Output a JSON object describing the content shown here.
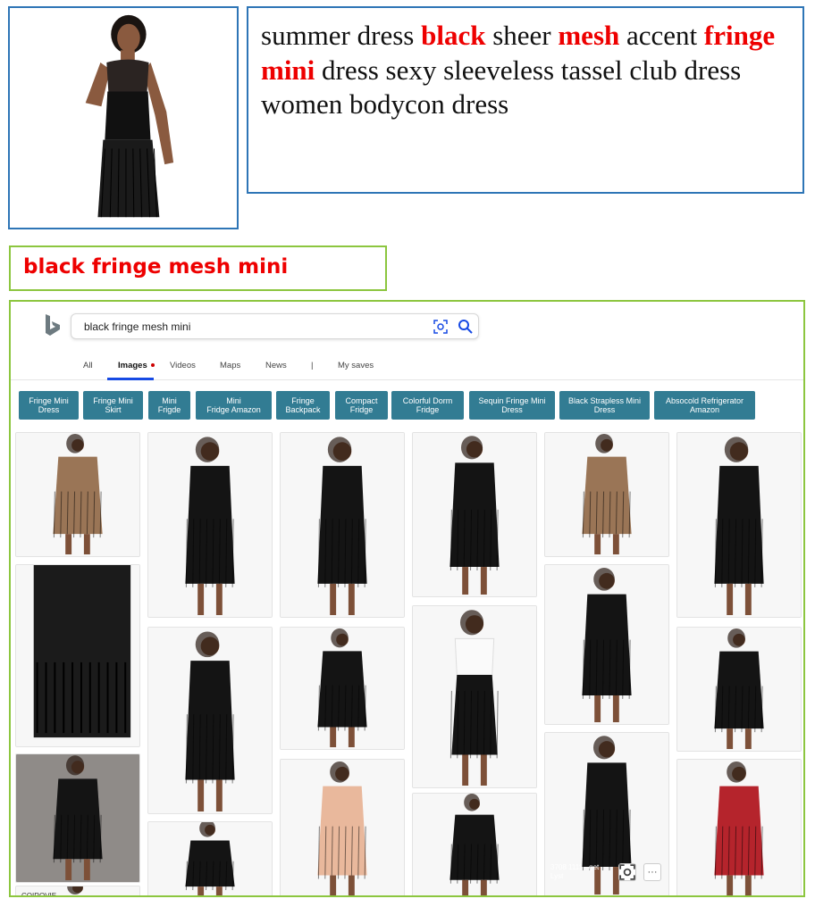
{
  "product_title": {
    "parts": [
      {
        "text": "summer dress ",
        "highlight": false
      },
      {
        "text": "black",
        "highlight": true
      },
      {
        "text": " sheer ",
        "highlight": false
      },
      {
        "text": "mesh",
        "highlight": true
      },
      {
        "text": " accent ",
        "highlight": false
      },
      {
        "text": "fringe mini",
        "highlight": true
      },
      {
        "text": " dress sexy sleeveless tassel club dress women bodycon dress",
        "highlight": false
      }
    ]
  },
  "query": "black fringe mesh mini",
  "search": {
    "value": "black fringe mesh mini",
    "logo_icon": "bing-logo-icon",
    "visual_search_icon": "camera-search-icon",
    "search_icon": "magnifier-icon"
  },
  "tabs": [
    {
      "label": "All"
    },
    {
      "label": "Images"
    },
    {
      "label": "Videos"
    },
    {
      "label": "Maps"
    },
    {
      "label": "News"
    },
    {
      "label": "|"
    },
    {
      "label": "My saves"
    }
  ],
  "chips": [
    {
      "line1": "Fringe Mini",
      "line2": "Dress"
    },
    {
      "line1": "Fringe Mini",
      "line2": "Skirt"
    },
    {
      "line1": "Mini",
      "line2": "Frigde"
    },
    {
      "line1": "Mini",
      "line2": "Fridge Amazon"
    },
    {
      "line1": "Fringe",
      "line2": "Backpack"
    },
    {
      "line1": "Compact",
      "line2": "Fridge"
    },
    {
      "line1": "Colorful Dorm",
      "line2": "Fridge"
    },
    {
      "line1": "Sequin Fringe Mini",
      "line2": "Dress"
    },
    {
      "line1": "Black Strapless Mini",
      "line2": "Dress"
    },
    {
      "line1": "Absocold Refrigerator",
      "line2": "Amazon"
    }
  ],
  "card_brand_text": "COIROVIE",
  "hover_overlay": {
    "source_line1": "3708 1111 · get",
    "source_line2": "Lyst",
    "more_label": "···"
  },
  "colors": {
    "accent": "#327c93",
    "highlight": "#ee0000",
    "border_blue": "#2e75b6",
    "border_green": "#8cc63f"
  }
}
